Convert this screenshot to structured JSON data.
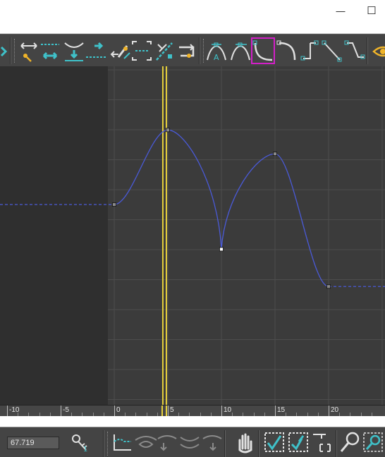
{
  "window": {
    "minimize_glyph": "—",
    "maximize_glyph": "☐"
  },
  "toolbar": {
    "active_tool": "tangent-custom",
    "tools": [
      "move-keys-horizontal",
      "insert-keys",
      "slide-keys",
      "move-keys-vertical",
      "scale-keys",
      "scale-values",
      "draw-curves",
      "region-tool",
      "snap-frames",
      "auto-tangent",
      "spline-tangent",
      "fast-tangent",
      "slow-tangent",
      "step-tangent",
      "linear-tangent",
      "smooth-tangent",
      "show-keyable"
    ]
  },
  "curve_editor": {
    "x_axis": {
      "ruler_labels": [
        "-10",
        "-5",
        "0",
        "5",
        "10",
        "15",
        "20"
      ],
      "ruler_values": [
        -10,
        -5,
        0,
        5,
        10,
        15,
        20
      ]
    },
    "time_slider_frame": 4.7,
    "keys": [
      {
        "frame": 0,
        "value": 0,
        "selected": false
      },
      {
        "frame": 5,
        "value": 100,
        "selected": false
      },
      {
        "frame": 10,
        "value": -60,
        "selected": true
      },
      {
        "frame": 15,
        "value": 68,
        "selected": false
      },
      {
        "frame": 20,
        "value": -110,
        "selected": false
      }
    ],
    "curve_color": "#4a5ad8",
    "time_line_color": "#e8d23c",
    "selection_box_color": "#d21fc7"
  },
  "status_bar": {
    "value": "67.719",
    "tools": [
      "key-stats",
      "track-view-frame",
      "show-selected-key-stats",
      "pan",
      "frame-horizontal",
      "frame-value",
      "zoom",
      "zoom-region"
    ]
  }
}
